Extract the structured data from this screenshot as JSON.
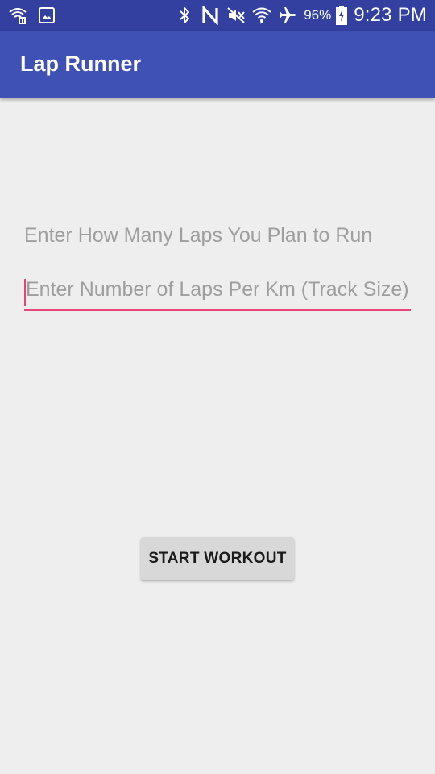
{
  "status_bar": {
    "left_icons": [
      "wifi-call-icon",
      "image-icon"
    ],
    "right_icons": [
      "bluetooth-icon",
      "nfc-icon",
      "mute-icon",
      "wifi-icon",
      "airplane-mode-icon",
      "battery-charging-icon"
    ],
    "battery_percent": "96%",
    "time": "9:23 PM",
    "background_color": "#3340a0"
  },
  "app_bar": {
    "title": "Lap Runner",
    "background_color": "#3f51b5"
  },
  "form": {
    "laps_planned": {
      "value": "",
      "placeholder": "Enter How Many Laps You Plan to Run"
    },
    "laps_per_km": {
      "value": "",
      "placeholder": "Enter Number of Laps Per Km (Track Size)",
      "focused": true,
      "accent_color": "#e94378"
    }
  },
  "actions": {
    "start_label": "START WORKOUT"
  }
}
